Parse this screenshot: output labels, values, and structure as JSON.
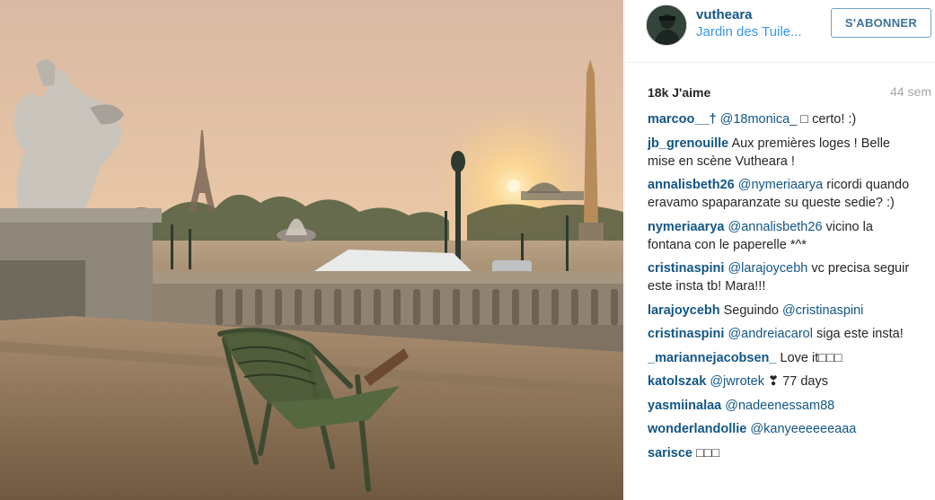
{
  "post": {
    "username": "vutheara",
    "location": "Jardin des Tuile...",
    "follow_label": "S'ABONNER",
    "likes": "18k J'aime",
    "time": "44 sem"
  },
  "comments": [
    {
      "author": "marcoo__†",
      "mention": "@18monica_",
      "text": " □ certo! :)"
    },
    {
      "author": "jb_grenouille",
      "mention": "",
      "text": "Aux premières loges ! Belle mise en scène Vutheara !"
    },
    {
      "author": "annalisbeth26",
      "mention": "@nymeriaarya",
      "text": " ricordi quando eravamo spaparanzate su queste sedie? :)"
    },
    {
      "author": "nymeriaarya",
      "mention": "@annalisbeth26",
      "text": " vicino la fontana con le paperelle *^*"
    },
    {
      "author": "cristinaspini",
      "mention": "@larajoycebh",
      "text": " vc precisa seguir este insta tb! Mara!!!"
    },
    {
      "author": "larajoycebh",
      "mention": "",
      "text": "Seguindo ",
      "mention_after": "@cristinaspini"
    },
    {
      "author": "cristinaspini",
      "mention": "@andreiacarol",
      "text": " siga este insta!"
    },
    {
      "author": "_mariannejacobsen_",
      "mention": "",
      "text": "Love it□□□"
    },
    {
      "author": "katolszak",
      "mention": "@jwrotek",
      "text": " ❣ 77 days"
    },
    {
      "author": "yasmiinalaa",
      "mention": "@nadeenessam88",
      "text": ""
    },
    {
      "author": "wonderlandollie",
      "mention": "@kanyeeeeeeaaa",
      "text": ""
    },
    {
      "author": "sarisce",
      "mention": "",
      "text": "□□□"
    }
  ],
  "colors": {
    "username": "#125688",
    "location": "#3897f0",
    "follow_border": "#70a1c9",
    "follow_text": "#3f729b",
    "time": "#a5a7aa"
  }
}
